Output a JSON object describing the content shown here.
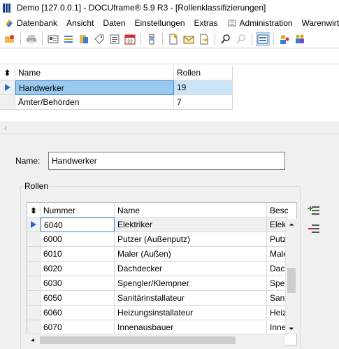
{
  "window": {
    "title": "Demo [127.0.0.1] - DOCUframe® 5.9 R3 - [Rollenklassifizierungen]"
  },
  "menu": {
    "items": [
      {
        "label": "Datenbank",
        "icon": "database-menu-icon"
      },
      {
        "label": "Ansicht"
      },
      {
        "label": "Daten"
      },
      {
        "label": "Einstellungen"
      },
      {
        "label": "Extras"
      },
      {
        "label": "Administration",
        "icon": "admin-menu-icon"
      },
      {
        "label": "Warenwirtschaft"
      }
    ]
  },
  "upper_grid": {
    "columns": [
      "Name",
      "Rollen"
    ],
    "rows": [
      {
        "name": "Handwerker",
        "roles": "19",
        "selected": true
      },
      {
        "name": "Ämter/Behörden",
        "roles": "7",
        "selected": false
      }
    ]
  },
  "detail": {
    "name_label": "Name:",
    "name_value": "Handwerker",
    "roles_group_label": "Rollen"
  },
  "roles_grid": {
    "columns": [
      "Nummer",
      "Name",
      "Beschreibung"
    ],
    "rows": [
      {
        "number": "6040",
        "name": "Elektriker",
        "desc": "Elektriker",
        "selected": true
      },
      {
        "number": "6000",
        "name": "Putzer (Außenputz)",
        "desc": "Putzer"
      },
      {
        "number": "6010",
        "name": "Maler (Außen)",
        "desc": "Maler"
      },
      {
        "number": "6020",
        "name": "Dachdecker",
        "desc": "Dachdecker"
      },
      {
        "number": "6030",
        "name": "Spengler/Klempner",
        "desc": "Spengler"
      },
      {
        "number": "6050",
        "name": "Sanitärinstallateur",
        "desc": "Sanitär"
      },
      {
        "number": "6060",
        "name": "Heizungsinstallateur",
        "desc": "Heizung"
      },
      {
        "number": "6070",
        "name": "Innenausbauer",
        "desc": "Innen"
      }
    ]
  },
  "colors": {
    "selection": "#99c9ef",
    "selection_light": "#cce4f7",
    "indicator": "#1e6fd0",
    "app_icon": "#1f3f8f"
  }
}
